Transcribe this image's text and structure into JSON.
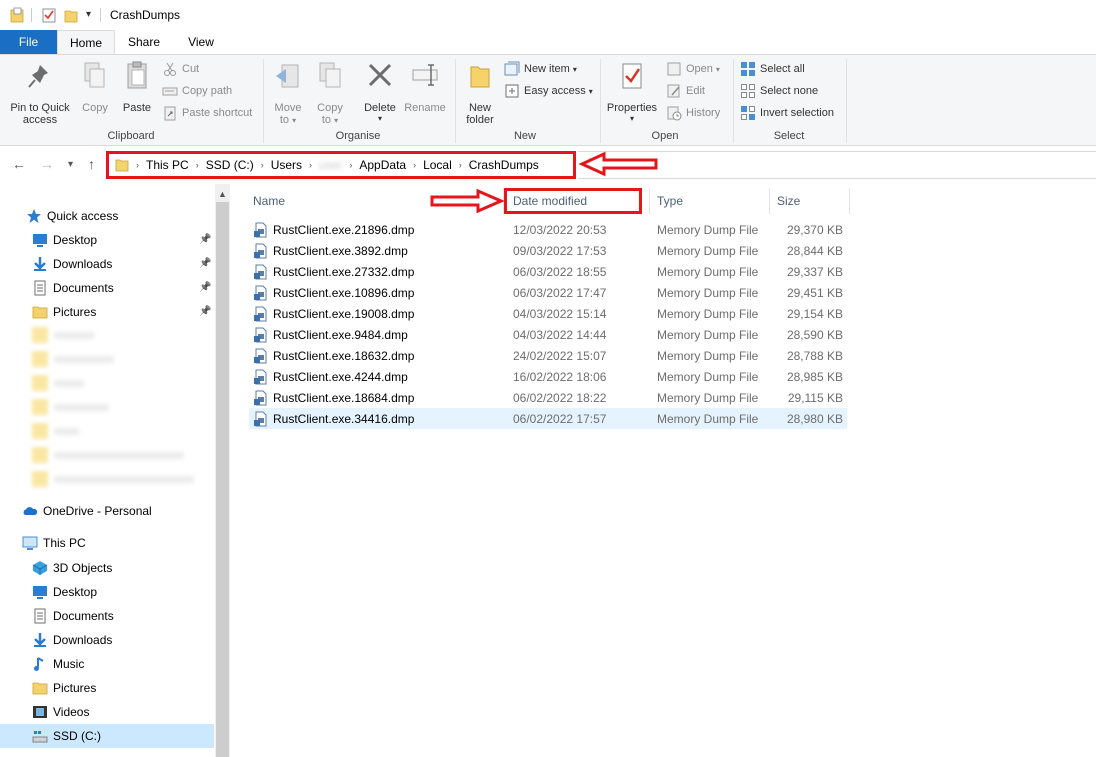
{
  "window": {
    "title": "CrashDumps"
  },
  "tabs": {
    "file": "File",
    "home": "Home",
    "share": "Share",
    "view": "View"
  },
  "ribbon": {
    "clipboard": {
      "label": "Clipboard",
      "pin_line1": "Pin to Quick",
      "pin_line2": "access",
      "copy": "Copy",
      "paste": "Paste",
      "cut": "Cut",
      "copy_path": "Copy path",
      "paste_shortcut": "Paste shortcut"
    },
    "organise": {
      "label": "Organise",
      "move_line1": "Move",
      "move_line2": "to",
      "copy_line1": "Copy",
      "copy_line2": "to",
      "delete": "Delete",
      "rename": "Rename"
    },
    "new": {
      "label": "New",
      "new_item": "New item",
      "easy_access": "Easy access",
      "new_folder_line1": "New",
      "new_folder_line2": "folder"
    },
    "open": {
      "label": "Open",
      "properties": "Properties",
      "open": "Open",
      "edit": "Edit",
      "history": "History"
    },
    "select": {
      "label": "Select",
      "select_all": "Select all",
      "select_none": "Select none",
      "invert": "Invert selection"
    }
  },
  "address": {
    "crumbs": [
      "This PC",
      "SSD (C:)",
      "Users",
      "user",
      "AppData",
      "Local",
      "CrashDumps"
    ]
  },
  "sidebar": {
    "quick_access": "Quick access",
    "quick_items": [
      {
        "label": "Desktop",
        "icon": "desktop-icon"
      },
      {
        "label": "Downloads",
        "icon": "downloads-icon"
      },
      {
        "label": "Documents",
        "icon": "documents-icon"
      },
      {
        "label": "Pictures",
        "icon": "pictures-icon"
      }
    ],
    "onedrive": "OneDrive - Personal",
    "this_pc": "This PC",
    "pc_items": [
      {
        "label": "3D Objects",
        "icon": "3d-objects-icon"
      },
      {
        "label": "Desktop",
        "icon": "desktop-icon"
      },
      {
        "label": "Documents",
        "icon": "documents-icon"
      },
      {
        "label": "Downloads",
        "icon": "downloads-icon"
      },
      {
        "label": "Music",
        "icon": "music-icon"
      },
      {
        "label": "Pictures",
        "icon": "pictures-icon"
      },
      {
        "label": "Videos",
        "icon": "videos-icon"
      },
      {
        "label": "SSD (C:)",
        "icon": "drive-icon"
      }
    ]
  },
  "columns": {
    "name": "Name",
    "date": "Date modified",
    "type": "Type",
    "size": "Size"
  },
  "files": [
    {
      "name": "RustClient.exe.21896.dmp",
      "date": "12/03/2022 20:53",
      "type": "Memory Dump File",
      "size": "29,370 KB"
    },
    {
      "name": "RustClient.exe.3892.dmp",
      "date": "09/03/2022 17:53",
      "type": "Memory Dump File",
      "size": "28,844 KB"
    },
    {
      "name": "RustClient.exe.27332.dmp",
      "date": "06/03/2022 18:55",
      "type": "Memory Dump File",
      "size": "29,337 KB"
    },
    {
      "name": "RustClient.exe.10896.dmp",
      "date": "06/03/2022 17:47",
      "type": "Memory Dump File",
      "size": "29,451 KB"
    },
    {
      "name": "RustClient.exe.19008.dmp",
      "date": "04/03/2022 15:14",
      "type": "Memory Dump File",
      "size": "29,154 KB"
    },
    {
      "name": "RustClient.exe.9484.dmp",
      "date": "04/03/2022 14:44",
      "type": "Memory Dump File",
      "size": "28,590 KB"
    },
    {
      "name": "RustClient.exe.18632.dmp",
      "date": "24/02/2022 15:07",
      "type": "Memory Dump File",
      "size": "28,788 KB"
    },
    {
      "name": "RustClient.exe.4244.dmp",
      "date": "16/02/2022 18:06",
      "type": "Memory Dump File",
      "size": "28,985 KB"
    },
    {
      "name": "RustClient.exe.18684.dmp",
      "date": "06/02/2022 18:22",
      "type": "Memory Dump File",
      "size": "29,115 KB"
    },
    {
      "name": "RustClient.exe.34416.dmp",
      "date": "06/02/2022 17:57",
      "type": "Memory Dump File",
      "size": "28,980 KB"
    }
  ],
  "colors": {
    "accent": "#1a6fc4",
    "annotation_red": "#e4161c",
    "selection": "#cce8ff"
  }
}
